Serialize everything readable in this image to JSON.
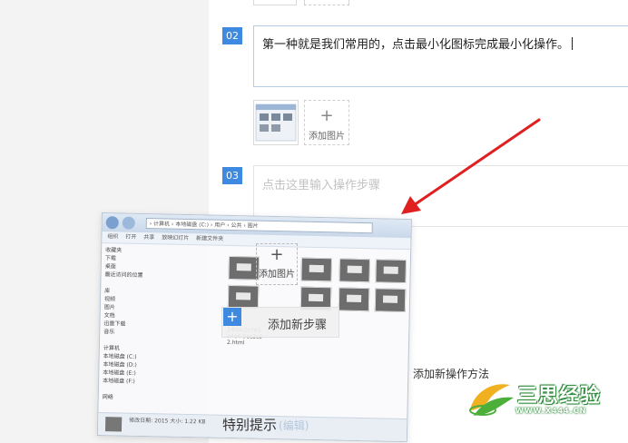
{
  "steps": [
    {
      "number": "02",
      "text": "第一种就是我们常用的，点击最小化图标完成最小化操作。"
    },
    {
      "number": "03",
      "placeholder": "点击这里输入操作步骤"
    }
  ],
  "add_image_label": "添加图片",
  "add_image_plus": "+",
  "ghost_add_image_label": "添加图片",
  "add_step": {
    "plus": "+",
    "label": "添加新步骤"
  },
  "add_method_label": "添加新操作方法",
  "tips": {
    "title": "特别提示",
    "edit": "(编辑)"
  },
  "watermark": {
    "brand": "三思经验",
    "url": "WWW.X444.CN"
  },
  "ghost_window": {
    "address": "› 计算机 › 本地磁盘 (C:) › 用户 › 公共 › 图片",
    "menu": [
      "组织",
      "打开",
      "共享",
      "放映幻灯片",
      "新建文件夹"
    ],
    "sidebar": [
      "收藏夹",
      "下载",
      "桌面",
      "最近访问的位置",
      "",
      "库",
      "视频",
      "图片",
      "文档",
      "迅雷下载",
      "音乐",
      "",
      "计算机",
      "本地磁盘 (C:)",
      "本地磁盘 (D:)",
      "本地磁盘 (E:)",
      "本地磁盘 (F:)",
      "",
      "网络"
    ],
    "file_label": "1400c2c7e5 a4e4-5ec2c3 2.html",
    "status": "修改日期: 2015 大小: 1.22 KB"
  },
  "colors": {
    "accent": "#3d8ae0",
    "arrow": "#e02020",
    "watermark": "#2d8a3a"
  }
}
